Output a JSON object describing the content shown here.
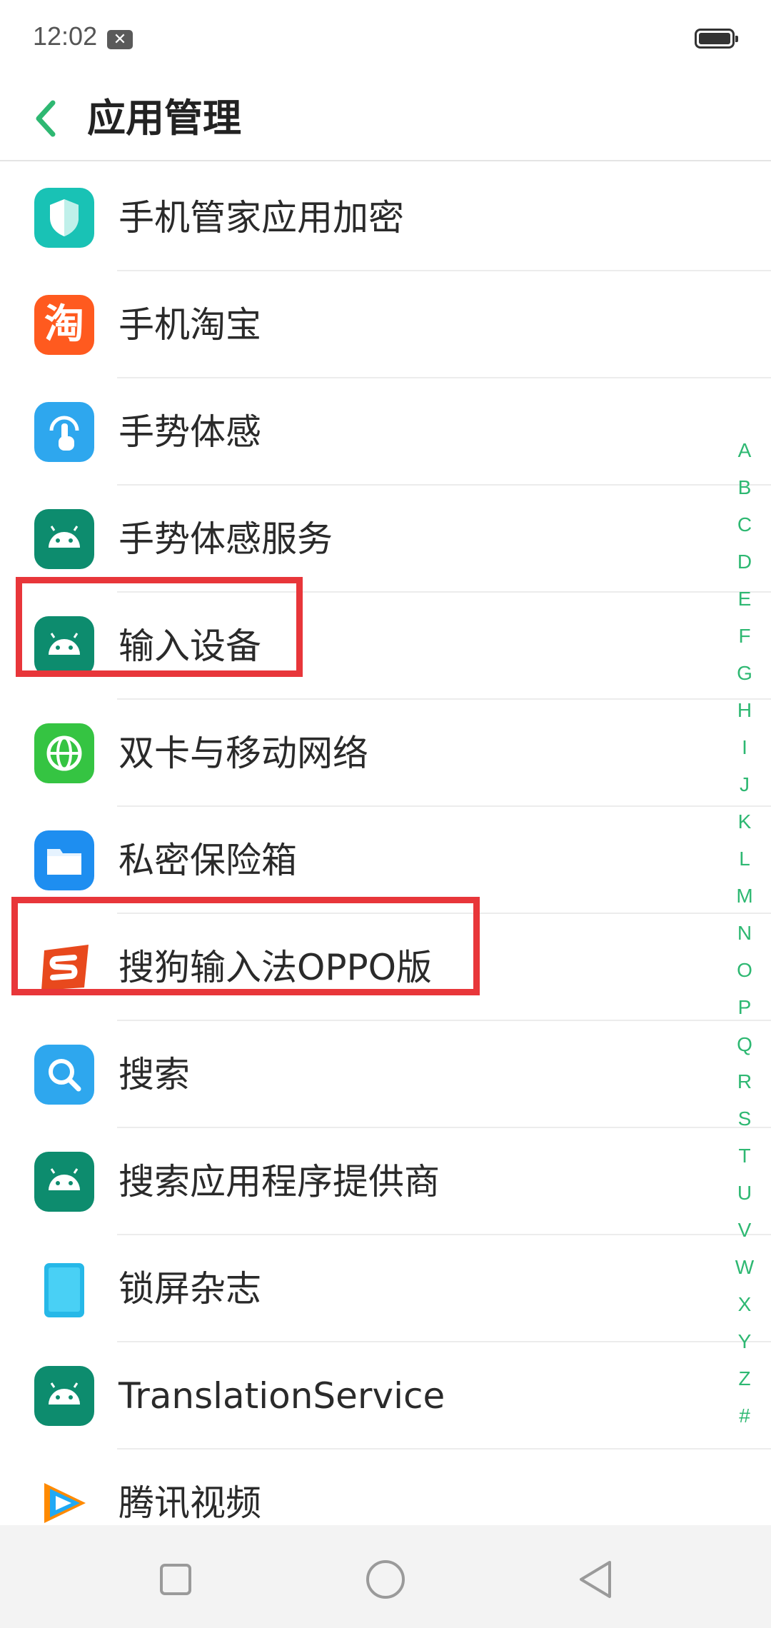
{
  "status_bar": {
    "time": "12:02"
  },
  "header": {
    "title": "应用管理"
  },
  "apps": [
    {
      "label": "手机管家应用加密",
      "icon": "shield-icon",
      "color": "#19c2b5"
    },
    {
      "label": "手机淘宝",
      "icon": "taobao-icon",
      "color": "#ff5a1f",
      "glyph": "淘"
    },
    {
      "label": "手势体感",
      "icon": "gesture-icon",
      "color": "#2ea7ee"
    },
    {
      "label": "手势体感服务",
      "icon": "android-icon",
      "color": "#0d8c6e"
    },
    {
      "label": "输入设备",
      "icon": "android-icon",
      "color": "#0d8c6e"
    },
    {
      "label": "双卡与移动网络",
      "icon": "globe-icon",
      "color": "#35c442"
    },
    {
      "label": "私密保险箱",
      "icon": "folder-icon",
      "color": "#1e8ef0"
    },
    {
      "label": "搜狗输入法OPPO版",
      "icon": "sogou-icon",
      "color": "#e8491d"
    },
    {
      "label": "搜索",
      "icon": "search-icon",
      "color": "#2ea7ee"
    },
    {
      "label": "搜索应用程序提供商",
      "icon": "android-icon",
      "color": "#0d8c6e"
    },
    {
      "label": "锁屏杂志",
      "icon": "phone-icon",
      "color": "#26b8e8"
    },
    {
      "label": "TranslationService",
      "icon": "android-icon",
      "color": "#0d8c6e"
    },
    {
      "label": "腾讯视频",
      "icon": "tencent-video-icon",
      "color": "#ff8a00"
    }
  ],
  "index_letters": [
    "A",
    "B",
    "C",
    "D",
    "E",
    "F",
    "G",
    "H",
    "I",
    "J",
    "K",
    "L",
    "M",
    "N",
    "O",
    "P",
    "Q",
    "R",
    "S",
    "T",
    "U",
    "V",
    "W",
    "X",
    "Y",
    "Z",
    "#"
  ],
  "highlighted_items": [
    "输入设备",
    "搜狗输入法OPPO版"
  ],
  "colors": {
    "accent": "#2eb872",
    "highlight": "#e8363a"
  }
}
